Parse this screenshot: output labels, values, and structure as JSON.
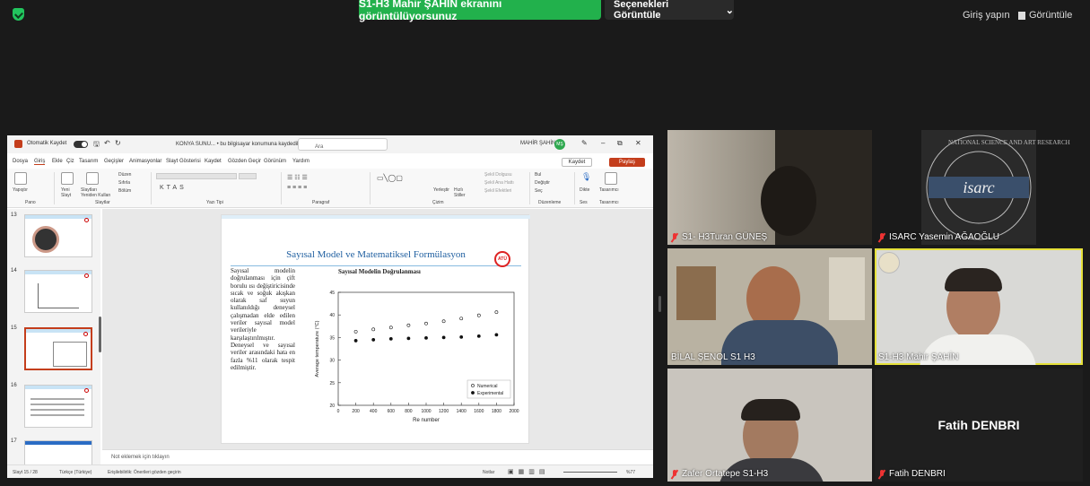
{
  "topbar": {
    "share_notice": "S1-H3 Mahir ŞAHİN ekranını görüntülüyorsunuz",
    "view_options": "Seçenekleri Görüntüle",
    "view_options_chevron": "⌄",
    "sign_in": "Giriş yapın",
    "view": "Görüntüle"
  },
  "ppt": {
    "autosave": "Otomatik Kaydet",
    "filename": "KONYA SUNU... • bu bilgisayar konumuna kaydedildi ⌄",
    "search": "Ara",
    "user": "MAHİR ŞAHİN",
    "user_initials": "MŞ",
    "menu": [
      "Dosya",
      "Giriş",
      "Ekle",
      "Çiz",
      "Tasarım",
      "Geçişler",
      "Animasyonlar",
      "Slayt Gösterisi",
      "Kaydet",
      "Gözden Geçir",
      "Görünüm",
      "Yardım"
    ],
    "save_btn": "Kaydet",
    "share_btn": "Paylaş",
    "ribbon": {
      "paste": "Yapıştır",
      "new_slide": "Yeni Slayt",
      "reuse": "Slaytları Yeniden Kullan",
      "layout": "Düzen",
      "reset": "Sıfırla",
      "section": "Bölüm",
      "arrange": "Yerleştir",
      "quick_styles": "Hızlı Stiller",
      "shape_fill": "Şekil Dolgusu",
      "shape_outline": "Şekil Ana Hattı",
      "shape_effects": "Şekil Efektleri",
      "find": "Bul",
      "replace": "Değiştir",
      "select": "Seç",
      "dictate": "Dikte",
      "designer": "Tasarımcı",
      "groups": [
        "Pano",
        "Slaytlar",
        "Yazı Tipi",
        "Paragraf",
        "Çizim",
        "Düzenleme",
        "Ses",
        "Tasarımcı"
      ]
    },
    "thumb_numbers": [
      "13",
      "14",
      "15",
      "16",
      "17"
    ],
    "notes_placeholder": "Not eklemek için tıklayın",
    "status": {
      "slide": "Slayt 15 / 28",
      "lang": "Türkçe (Türkiye)",
      "accessibility": "Erişilebilirlik: Önerileri gözden geçirin",
      "notes": "Notlar",
      "zoom": "%77"
    }
  },
  "slide": {
    "title": "Sayısal Model ve Matematiksel Formülasyon",
    "logo": "ATÜ",
    "body": "Sayısal modelin doğrulanması için çift borulu ısı değiştiricisinde sıcak ve soğuk akışkan olarak saf suyun kullanıldığı deneysel çalışmadan elde edilen veriler sayısal model verileriyle karşılaştırılmıştır. Deneysel ve sayısal veriler arasındaki hata en fazla %11 olarak tespit edilmiştir."
  },
  "chart_data": {
    "type": "scatter",
    "title": "Sayısal Modelin Doğrulanması",
    "xlabel": "Re number",
    "ylabel": "Average temperature (°C)",
    "xlim": [
      0,
      2000
    ],
    "ylim": [
      20,
      45
    ],
    "xticks": [
      0,
      200,
      400,
      600,
      800,
      1000,
      1200,
      1400,
      1600,
      1800,
      2000
    ],
    "yticks": [
      20,
      25,
      30,
      35,
      40,
      45
    ],
    "legend_position": "bottom-right",
    "series": [
      {
        "name": "Numerical",
        "marker": "open-circle",
        "x": [
          200,
          400,
          600,
          800,
          1000,
          1200,
          1400,
          1600,
          1800
        ],
        "y": [
          36.3,
          36.8,
          37.2,
          37.7,
          38.1,
          38.6,
          39.2,
          39.9,
          40.6
        ]
      },
      {
        "name": "Experimental",
        "marker": "filled-circle",
        "x": [
          200,
          400,
          600,
          800,
          1000,
          1200,
          1400,
          1600,
          1800
        ],
        "y": [
          34.3,
          34.5,
          34.7,
          34.8,
          34.9,
          35.0,
          35.1,
          35.3,
          35.6
        ]
      }
    ]
  },
  "participants": [
    {
      "name": "S1- H3Turan GÜNEŞ",
      "muted": true
    },
    {
      "name": "ISARC Yasemin AĞAOĞLU",
      "muted": true,
      "logo_text": "isarc",
      "logo_ring": "NATIONAL SCIENCE AND ART RESEARCH"
    },
    {
      "name": "BİLAL ŞENOL S1 H3",
      "muted": false
    },
    {
      "name": "S1-H3 Mahir ŞAHİN",
      "muted": false,
      "active_speaker": true
    },
    {
      "name": "Zafer Ortatepe S1-H3",
      "muted": true
    },
    {
      "name": "Fatih DENBRI",
      "muted": true,
      "video_off_label": "Fatih DENBRI"
    }
  ]
}
